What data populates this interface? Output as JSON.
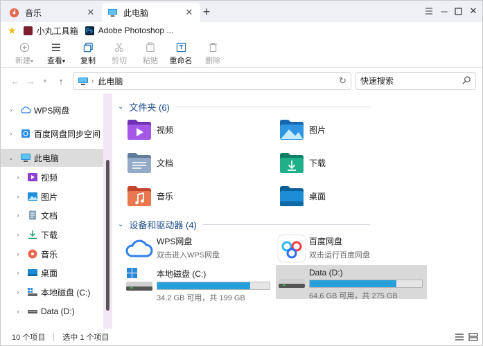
{
  "tabs": [
    {
      "label": "音乐",
      "icon": "music-icon",
      "active": false
    },
    {
      "label": "此电脑",
      "icon": "computer-icon",
      "active": true
    }
  ],
  "bookmarks": [
    {
      "label": "小丸工具箱",
      "icon": "toolbox-icon"
    },
    {
      "label": "Adobe Photoshop ...",
      "icon": "photoshop-icon"
    }
  ],
  "toolbar": {
    "new_label": "新建",
    "view_label": "查看",
    "copy_label": "复制",
    "cut_label": "剪切",
    "paste_label": "粘贴",
    "rename_label": "重命名",
    "delete_label": "删除"
  },
  "address": {
    "path": "此电脑",
    "search_placeholder": "快速搜索"
  },
  "sidebar": {
    "items": [
      {
        "label": "WPS网盘",
        "icon": "cloud-icon"
      },
      {
        "label": "百度网盘同步空间",
        "icon": "sync-icon"
      },
      {
        "label": "此电脑",
        "icon": "computer-icon"
      },
      {
        "label": "视频",
        "icon": "video-folder-icon"
      },
      {
        "label": "图片",
        "icon": "pictures-folder-icon"
      },
      {
        "label": "文档",
        "icon": "documents-folder-icon"
      },
      {
        "label": "下载",
        "icon": "downloads-icon"
      },
      {
        "label": "音乐",
        "icon": "music-icon"
      },
      {
        "label": "桌面",
        "icon": "desktop-icon"
      },
      {
        "label": "本地磁盘 (C:)",
        "icon": "windows-drive-icon"
      },
      {
        "label": "Data (D:)",
        "icon": "drive-icon"
      }
    ]
  },
  "main": {
    "folders_header": "文件夹 (6)",
    "folders": [
      {
        "label": "视频",
        "icon": "video-folder-icon"
      },
      {
        "label": "图片",
        "icon": "pictures-folder-icon"
      },
      {
        "label": "文档",
        "icon": "documents-folder-icon"
      },
      {
        "label": "下载",
        "icon": "downloads-folder-icon"
      },
      {
        "label": "音乐",
        "icon": "music-folder-icon"
      },
      {
        "label": "桌面",
        "icon": "desktop-folder-icon"
      }
    ],
    "devices_header": "设备和驱动器 (4)",
    "devices": [
      {
        "name": "WPS网盘",
        "sub": "双击进入WPS网盘",
        "icon": "wps-cloud-icon"
      },
      {
        "name": "百度网盘",
        "sub": "双击运行百度网盘",
        "icon": "baidu-cloud-icon"
      },
      {
        "name": "本地磁盘 (C:)",
        "sub": "34.2 GB 可用，共 199 GB",
        "icon": "windows-drive-icon",
        "used_fraction": 0.83
      },
      {
        "name": "Data (D:)",
        "sub": "64.6 GB 可用，共 275 GB",
        "icon": "drive-icon",
        "used_fraction": 0.77
      }
    ]
  },
  "status": {
    "items": "10 个项目",
    "selected": "选中 1 个项目"
  },
  "colors": {
    "accent": "#26a0da",
    "header_blue": "#1a4c8b"
  }
}
